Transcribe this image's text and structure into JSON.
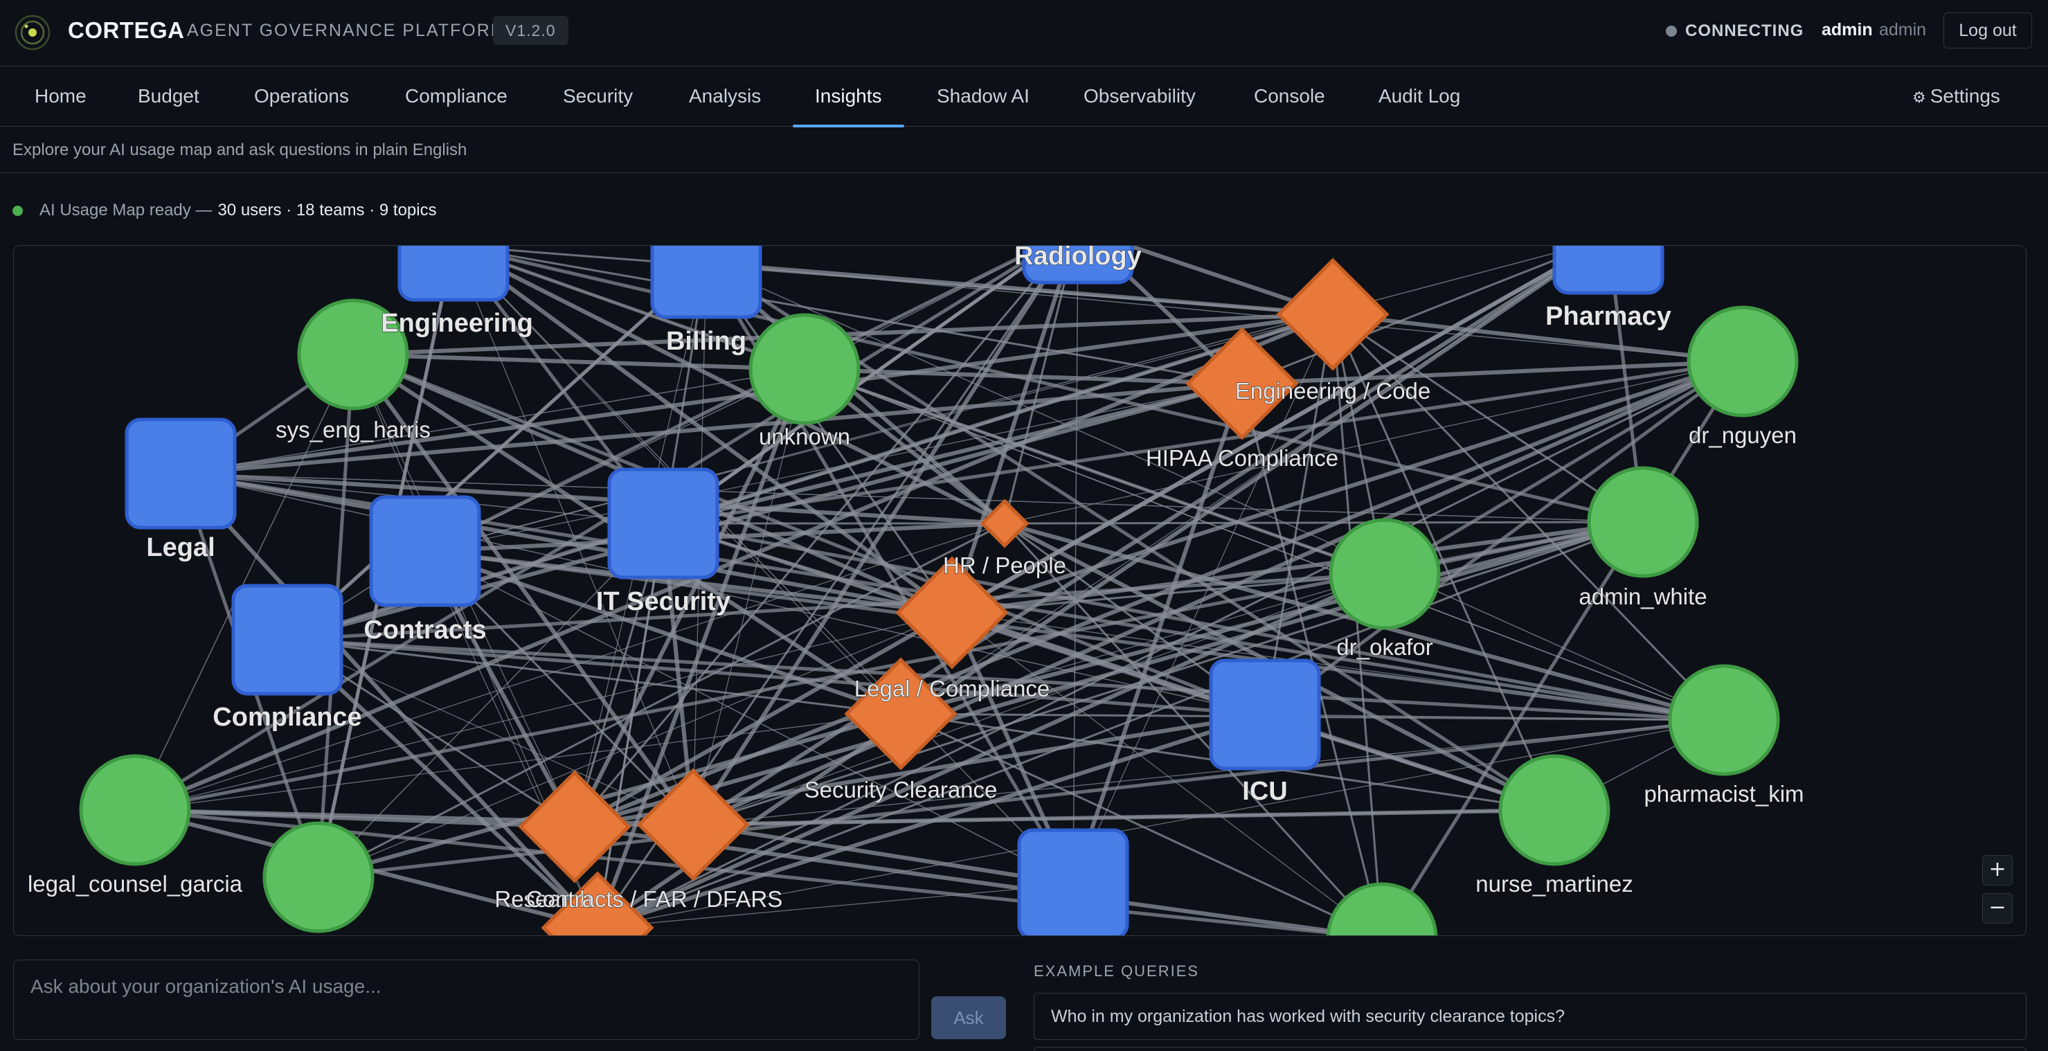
{
  "header": {
    "brand": "CORTEGA",
    "platform": "AGENT GOVERNANCE PLATFORM",
    "version": "V1.2.0",
    "connection_status": "CONNECTING",
    "user_name": "admin",
    "user_role": "admin",
    "logout_label": "Log out"
  },
  "nav": {
    "tabs": [
      {
        "label": "Home"
      },
      {
        "label": "Budget"
      },
      {
        "label": "Operations"
      },
      {
        "label": "Compliance"
      },
      {
        "label": "Security"
      },
      {
        "label": "Analysis"
      },
      {
        "label": "Insights",
        "active": true
      },
      {
        "label": "Shadow AI"
      },
      {
        "label": "Observability"
      },
      {
        "label": "Console"
      },
      {
        "label": "Audit Log"
      }
    ],
    "settings_label": "Settings"
  },
  "subtitle": "Explore your AI usage map and ask questions in plain English",
  "status": {
    "text": "AI Usage Map ready —",
    "stats": "30 users · 18 teams · 9 topics"
  },
  "colors": {
    "team": "#4a7fe8",
    "user": "#5cbf60",
    "topic": "#e8793a",
    "edge": "#8b8f9a",
    "accent": "#58a6ff"
  },
  "graph": {
    "teams": [
      {
        "id": "engineering",
        "label": "Engineering"
      },
      {
        "id": "billing",
        "label": "Billing"
      },
      {
        "id": "radiology",
        "label": "Radiology"
      },
      {
        "id": "pharmacy",
        "label": "Pharmacy"
      },
      {
        "id": "legal",
        "label": "Legal"
      },
      {
        "id": "contracts",
        "label": "Contracts"
      },
      {
        "id": "it_security",
        "label": "IT Security"
      },
      {
        "id": "compliance",
        "label": "Compliance"
      },
      {
        "id": "icu",
        "label": "ICU"
      },
      {
        "id": "team_bottom",
        "label": ""
      }
    ],
    "users": [
      {
        "id": "sys_eng_harris",
        "label": "sys_eng_harris"
      },
      {
        "id": "unknown",
        "label": "unknown"
      },
      {
        "id": "dr_nguyen",
        "label": "dr_nguyen"
      },
      {
        "id": "admin_white",
        "label": "admin_white"
      },
      {
        "id": "dr_okafor",
        "label": "dr_okafor"
      },
      {
        "id": "pharmacist_kim",
        "label": "pharmacist_kim"
      },
      {
        "id": "nurse_martinez",
        "label": "nurse_martinez"
      },
      {
        "id": "legal_counsel_garcia",
        "label": "legal_counsel_garcia"
      },
      {
        "id": "user_bottom_left",
        "label": ""
      },
      {
        "id": "user_bottom_right",
        "label": ""
      }
    ],
    "topics": [
      {
        "id": "eng_code",
        "label": "Engineering / Code"
      },
      {
        "id": "hipaa",
        "label": "HIPAA Compliance"
      },
      {
        "id": "hr_people",
        "label": "HR / People"
      },
      {
        "id": "legal_compliance",
        "label": "Legal / Compliance"
      },
      {
        "id": "security_clearance",
        "label": "Security Clearance"
      },
      {
        "id": "research",
        "label": "Research"
      },
      {
        "id": "contracts_far",
        "label": "Contracts / FAR / DFARS"
      },
      {
        "id": "topic_bottom",
        "label": ""
      }
    ]
  },
  "zoom": {
    "in_label": "+",
    "out_label": "−"
  },
  "query": {
    "placeholder": "Ask about your organization's AI usage...",
    "ask_label": "Ask",
    "examples_label": "EXAMPLE QUERIES",
    "examples": [
      "Who in my organization has worked with security clearance topics?"
    ]
  }
}
